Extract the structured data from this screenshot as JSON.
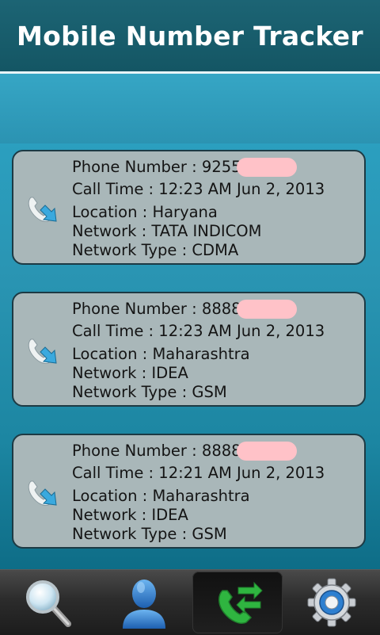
{
  "app": {
    "title": "Mobile Number Tracker"
  },
  "calls": [
    {
      "phone_label": "Phone Number : ",
      "phone_number": "92559",
      "call_time": "Call Time : 12:23 AM Jun 2, 2013",
      "location": "Location : Haryana",
      "network": "Network : TATA INDICOM",
      "network_type": "Network Type : CDMA"
    },
    {
      "phone_label": "Phone Number : ",
      "phone_number": "88889",
      "call_time": "Call Time : 12:23 AM Jun 2, 2013",
      "location": "Location : Maharashtra",
      "network": "Network : IDEA",
      "network_type": "Network Type : GSM"
    },
    {
      "phone_label": "Phone Number : ",
      "phone_number": "88889",
      "call_time": "Call Time : 12:21 AM Jun 2, 2013",
      "location": "Location : Maharashtra",
      "network": "Network : IDEA",
      "network_type": "Network Type : GSM"
    }
  ],
  "tabs": [
    {
      "icon": "search-icon",
      "active": false
    },
    {
      "icon": "contact-icon",
      "active": false
    },
    {
      "icon": "call-log-icon",
      "active": true
    },
    {
      "icon": "settings-gear-icon",
      "active": false
    }
  ],
  "colors": {
    "header": "#1c6474",
    "card": "#a9b7b9",
    "accent_call_arrow": "#3aa9de",
    "active_call_icon": "#2fb540",
    "redaction": "#ffc2c8"
  }
}
